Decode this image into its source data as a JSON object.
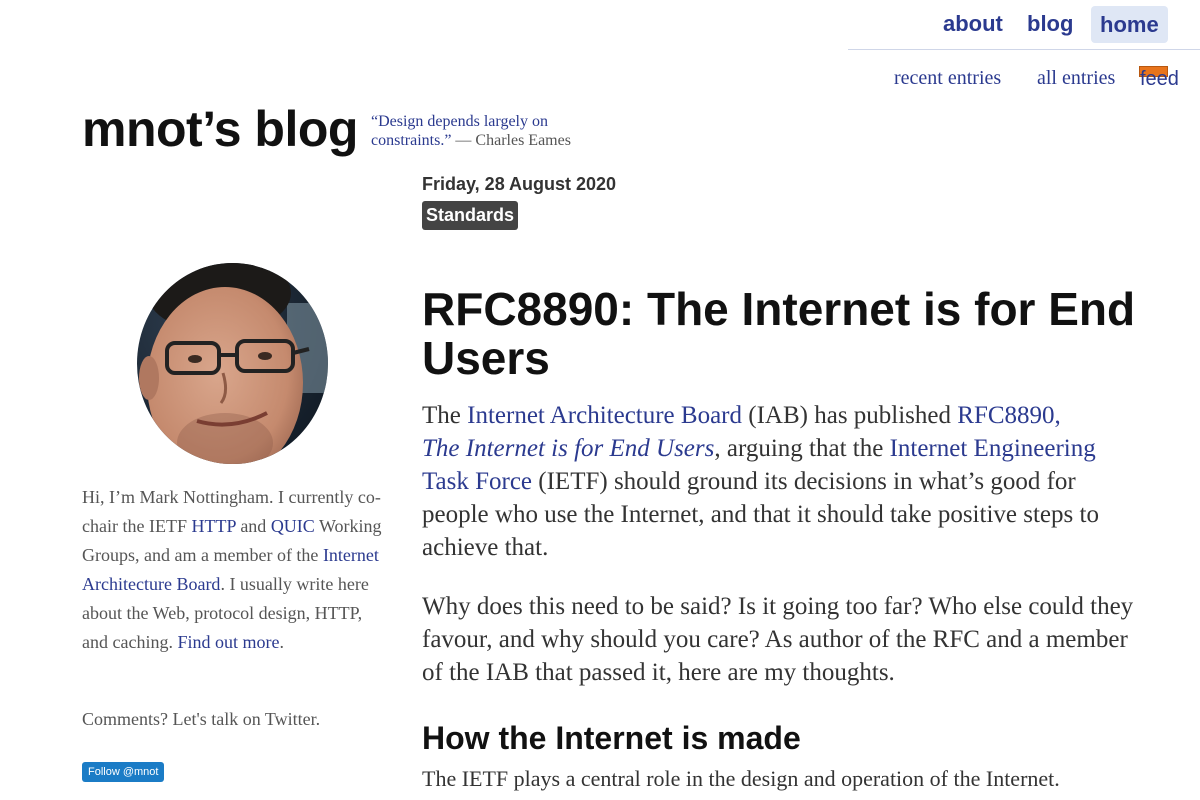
{
  "nav": {
    "about": "about",
    "blog": "blog",
    "home": "home",
    "recent": "recent entries",
    "all": "all entries",
    "feed": "feed"
  },
  "site": {
    "title": "mnot’s blog",
    "tagline_quote": "“Design depends largely on constraints.”",
    "tagline_author": " — Charles Eames"
  },
  "sidebar": {
    "bio": {
      "t1": "Hi, I’m Mark Nottingham. I currently co-chair the IETF ",
      "link_http": "HTTP",
      "t2": " and ",
      "link_quic": "QUIC",
      "t3": " Working Groups, and am a member of the ",
      "link_iab": "Internet Architecture Board",
      "t4": ". I usually write here about the Web, protocol design, HTTP, and caching. ",
      "link_more": "Find out more",
      "t5": "."
    },
    "comments": "Comments? Let's talk on Twitter.",
    "follow": "Follow @mnot"
  },
  "post": {
    "date": "Friday, 28 August 2020",
    "category": "Standards",
    "title": "RFC8890: The Internet is for End Users",
    "p1": {
      "t1": "The ",
      "link_iab": "Internet Architecture Board",
      "t2": " (IAB) has published ",
      "link_rfc": "RFC8890,",
      "link_rfc_title": "The Internet is for End Users",
      "t3": ", arguing that the ",
      "link_ietf": "Internet Engineering Task Force",
      "t4": " (IETF) should ground its decisions in what’s good for people who use the Internet, and that it should take positive steps to achieve that."
    },
    "p2": "Why does this need to be said? Is it going too far? Who else could they favour, and why should you care? As author of the RFC and a member of the IAB that passed it, here are my thoughts.",
    "heading": "How the Internet is made",
    "p3": "The IETF plays a central role in the design and operation of the Internet."
  }
}
